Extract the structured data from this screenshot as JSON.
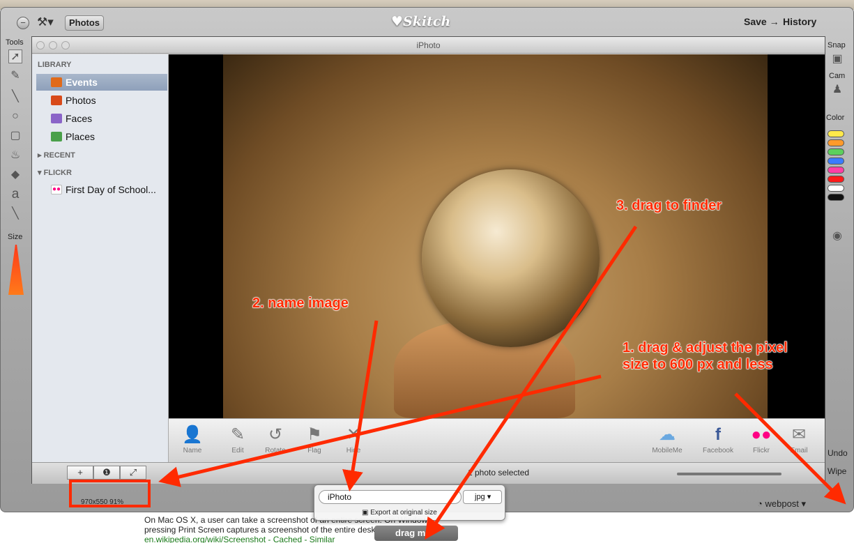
{
  "skitch": {
    "photos_label": "Photos",
    "logo": "Skitch",
    "save_label": "Save",
    "history_label": "History",
    "tools_label": "Tools",
    "size_label": "Size",
    "snap_label": "Snap",
    "cam_label": "Cam",
    "color_label": "Color",
    "undo_label": "Undo",
    "wipe_label": "Wipe",
    "dimensions": "970x550 91%",
    "webpost_label": "webpost",
    "colors": [
      "#ffe94a",
      "#ff9a2a",
      "#5cd05c",
      "#3b7bff",
      "#ff3fa5",
      "#ff1a1a",
      "#ffffff",
      "#111111"
    ]
  },
  "iphoto": {
    "window_title": "iPhoto",
    "library_header": "LIBRARY",
    "library_items": [
      "Events",
      "Photos",
      "Faces",
      "Places"
    ],
    "recent_header": "RECENT",
    "flickr_header": "FLICKR",
    "flickr_items": [
      "First Day of School..."
    ],
    "toolbar_items": [
      "Name",
      "Edit",
      "Rotate",
      "Flag",
      "Hide"
    ],
    "share_items": [
      "MobileMe",
      "Facebook",
      "Flickr",
      "Email"
    ],
    "status_text": "1 photo selected"
  },
  "export": {
    "name_value": "iPhoto",
    "format": "jpg",
    "export_label": "Export at original size",
    "drag_label": "drag me"
  },
  "web_snippet": {
    "line1": "On Mac OS X, a user can take a screenshot of an entire screen. On Windows,",
    "line2": "pressing Print Screen captures a screenshot of the entire desktop",
    "line3": "en.wikipedia.org/wiki/Screenshot - Cached - Similar"
  },
  "annotations": {
    "step1": "1. drag & adjust the pixel size to 600 px and less",
    "step2": "2. name image",
    "step3": "3. drag to finder"
  }
}
